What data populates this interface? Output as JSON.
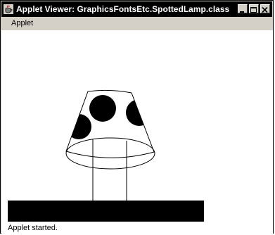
{
  "window": {
    "title": "Applet Viewer: GraphicsFontsEtc.SpottedLamp.class",
    "menu": {
      "applet_label": "Applet"
    },
    "status": "Applet started."
  },
  "colors": {
    "titlebar": "#000000",
    "window_frame": "#d4d0c8",
    "canvas": "#ffffff",
    "drawing": "#000000"
  },
  "icons": [
    "java-cup-icon",
    "minimize-icon",
    "maximize-icon",
    "close-icon"
  ]
}
